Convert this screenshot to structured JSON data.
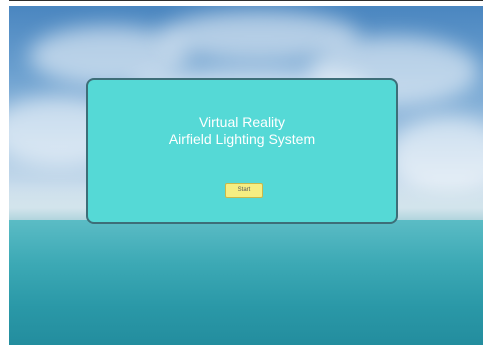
{
  "menu": {
    "title_line_1": "Virtual Reality",
    "title_line_2": "Airfield Lighting System",
    "start_label": "Start"
  },
  "colors": {
    "panel_fill": "#55d9d6",
    "panel_border": "#3d6e78",
    "button_fill": "#f5ee82",
    "title_text": "#ffffff"
  }
}
